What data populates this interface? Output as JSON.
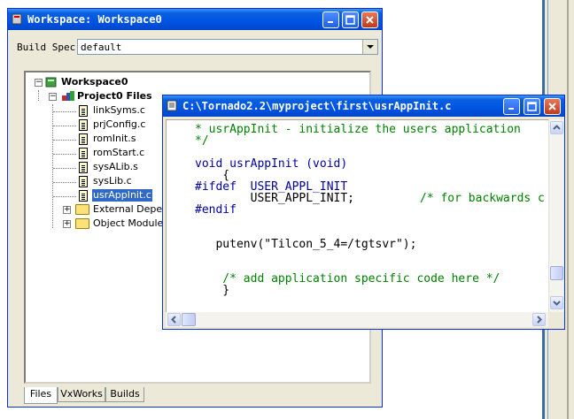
{
  "workspace_window": {
    "title": "Workspace: Workspace0",
    "build_spec_label": "Build Spec",
    "build_spec_value": "default",
    "tree": {
      "root": "Workspace0",
      "project": "Project0 Files",
      "files": [
        "linkSyms.c",
        "prjConfig.c",
        "romInit.s",
        "romStart.c",
        "sysALib.s",
        "sysLib.c",
        "usrAppInit.c"
      ],
      "selected_file": "usrAppInit.c",
      "folders": [
        "External Depend",
        "Object Modules"
      ]
    },
    "tabs": [
      "Files",
      "VxWorks",
      "Builds"
    ],
    "active_tab": "Files"
  },
  "editor_window": {
    "title": "C:\\Tornado2.2\\myproject\\first\\usrAppInit.c",
    "lines": [
      {
        "text": "* usrAppInit - initialize the users application",
        "color": "#008000"
      },
      {
        "text": "*/",
        "color": "#008000"
      },
      {
        "text": "",
        "color": "#000000"
      },
      {
        "text": "void usrAppInit (void)",
        "color": "#0000a0"
      },
      {
        "text": "    {",
        "color": "#000000"
      },
      {
        "text": "#ifdef  USER_APPL_INIT",
        "color": "#0000a0"
      },
      {
        "text": "        USER_APPL_INIT;",
        "color": "#000000"
      },
      {
        "text": "#endif",
        "color": "#0000a0"
      },
      {
        "text": "",
        "color": "#000000"
      },
      {
        "text": "",
        "color": "#000000"
      },
      {
        "text": "   putenv(\"Tilcon_5_4=/tgtsvr\");",
        "color": "#000000"
      },
      {
        "text": "",
        "color": "#000000"
      },
      {
        "text": "",
        "color": "#000000"
      },
      {
        "text": "    /* add application specific code here */",
        "color": "#008000"
      },
      {
        "text": "    }",
        "color": "#000000"
      }
    ],
    "inline_comment": "/* for backwards c"
  }
}
